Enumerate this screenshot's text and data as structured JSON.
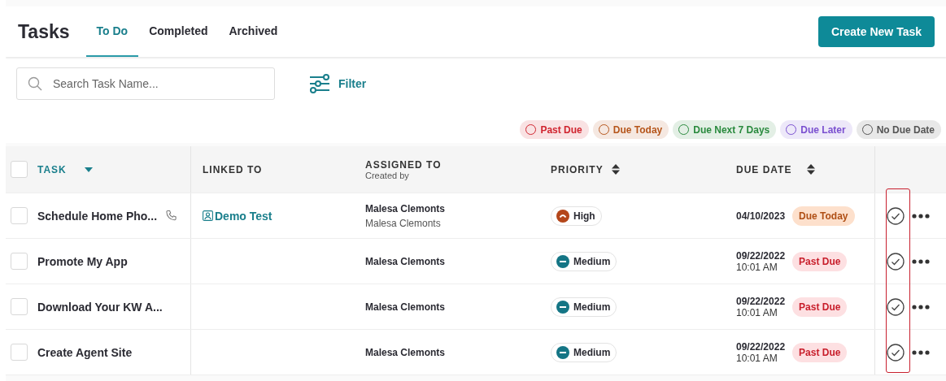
{
  "title": "Tasks",
  "tabs": [
    {
      "label": "To Do",
      "selected": true
    },
    {
      "label": "Completed",
      "selected": false
    },
    {
      "label": "Archived",
      "selected": false
    }
  ],
  "create_button": "Create New Task",
  "search": {
    "placeholder": "Search Task Name..."
  },
  "filter": "Filter",
  "legend": [
    {
      "label": "Past Due",
      "color": "#d0242f"
    },
    {
      "label": "Due Today",
      "color": "#b6561c"
    },
    {
      "label": "Due Next 7 Days",
      "color": "#2a8a3e"
    },
    {
      "label": "Due Later",
      "color": "#7a4fd0"
    },
    {
      "label": "No Due Date",
      "color": "#555555"
    }
  ],
  "select_all_checked": false,
  "columns": [
    {
      "label": "TASK",
      "sortable": true,
      "sorted": true
    },
    {
      "label": "LINKED TO",
      "sortable": false,
      "sorted": false
    },
    {
      "label": "ASSIGNED TO",
      "sublabel": "Created by",
      "sortable": false,
      "sorted": false
    },
    {
      "label": "PRIORITY",
      "sortable": true,
      "sorted": false
    },
    {
      "label": "DUE DATE",
      "sortable": true,
      "sorted": false
    }
  ],
  "rows": [
    {
      "checked": false,
      "task": "Schedule Home Pho...",
      "phone": true,
      "linked_to": "Demo Test",
      "assigned_to": "Malesa Clemonts",
      "created_by": "Malesa Clemonts",
      "priority": {
        "label": "High",
        "kind": "high"
      },
      "due_date": "04/10/2023",
      "status": {
        "label": "Due Today",
        "kind": "today"
      }
    },
    {
      "checked": false,
      "task": "Promote My App",
      "phone": false,
      "assigned_to": "Malesa Clemonts",
      "priority": {
        "label": "Medium",
        "kind": "medium"
      },
      "due_date": "09/22/2022",
      "due_time": "10:01 AM",
      "status": {
        "label": "Past Due",
        "kind": "past"
      }
    },
    {
      "checked": false,
      "task": "Download Your KW A...",
      "phone": false,
      "assigned_to": "Malesa Clemonts",
      "priority": {
        "label": "Medium",
        "kind": "medium"
      },
      "due_date": "09/22/2022",
      "due_time": "10:01 AM",
      "status": {
        "label": "Past Due",
        "kind": "past"
      }
    },
    {
      "checked": false,
      "task": "Create Agent Site",
      "phone": false,
      "assigned_to": "Malesa Clemonts",
      "priority": {
        "label": "Medium",
        "kind": "medium"
      },
      "due_date": "09/22/2022",
      "due_time": "10:01 AM",
      "status": {
        "label": "Past Due",
        "kind": "past"
      }
    }
  ]
}
